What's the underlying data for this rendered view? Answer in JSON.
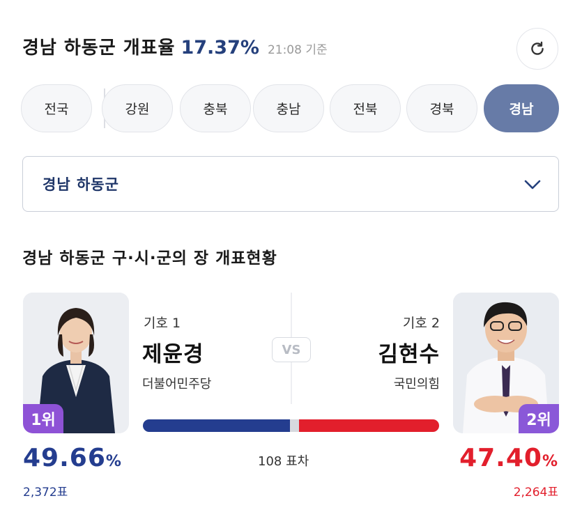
{
  "header": {
    "title": "경남 하동군 개표율",
    "rate": "17.37%",
    "time": "21:08 기준"
  },
  "refresh_icon": "refresh-icon",
  "regions": [
    "전국",
    "강원",
    "충북",
    "충남",
    "전북",
    "경북",
    "경남"
  ],
  "active_region": "경남",
  "district_select": {
    "value": "경남 하동군",
    "icon": "chevron-down-icon"
  },
  "section_title": "경남 하동군 구·시·군의 장 개표현황",
  "vs_label": "VS",
  "candidates": [
    {
      "rank": "1위",
      "symbol": "기호 1",
      "name": "제윤경",
      "party": "더불어민주당",
      "percent": "49.66",
      "percent_unit": "%",
      "votes": "2,372표",
      "color": "#243d8f"
    },
    {
      "rank": "2위",
      "symbol": "기호 2",
      "name": "김현수",
      "party": "국민의힘",
      "percent": "47.40",
      "percent_unit": "%",
      "votes": "2,264표",
      "color": "#e21f2c"
    }
  ],
  "vote_difference": "108 표차",
  "bar_shares": {
    "candidate1": 49.66,
    "candidate2": 47.4
  }
}
